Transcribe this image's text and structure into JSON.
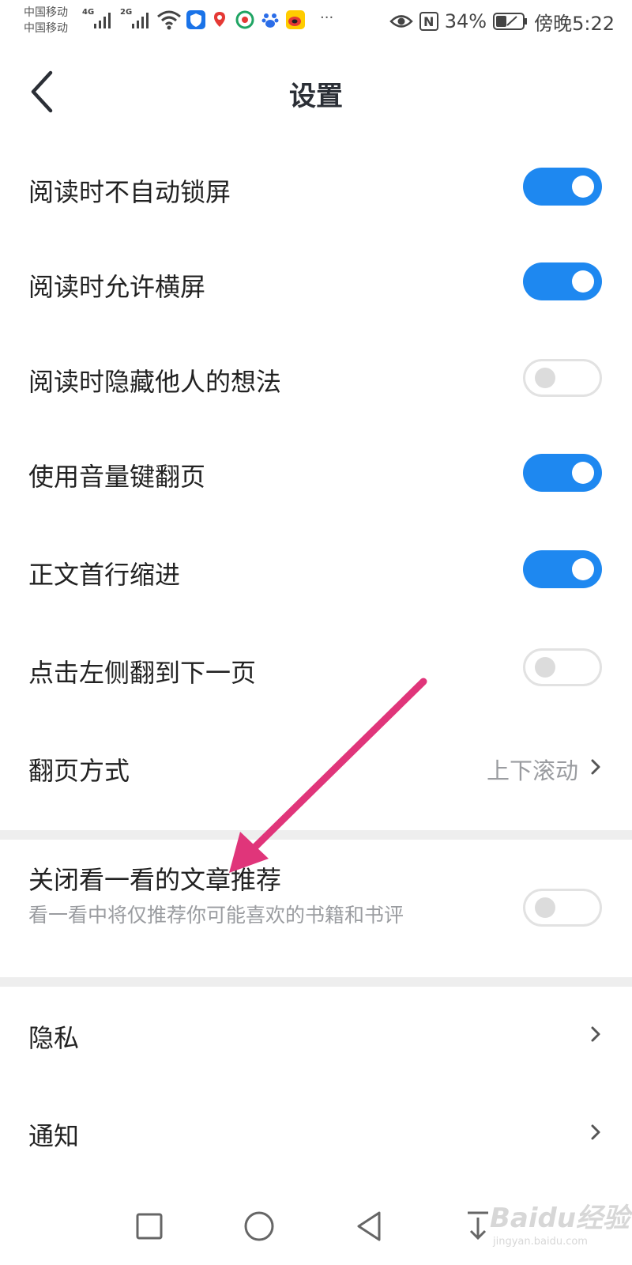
{
  "status_bar": {
    "carrier_1": "中国移动",
    "carrier_2": "中国移动",
    "net_1": "4G",
    "net_2": "2G",
    "nfc_label": "N",
    "battery": "34%",
    "time": "傍晚5:22",
    "more": "···",
    "icons": [
      "signal-4g-icon",
      "signal-2g-icon",
      "wifi-icon",
      "shield-app-icon",
      "map-app-icon",
      "browser-app-icon",
      "baidu-app-icon",
      "weibo-app-icon",
      "eye-icon",
      "nfc-icon",
      "battery-icon"
    ]
  },
  "header": {
    "title": "设置",
    "back_icon": "back-chevron-icon"
  },
  "settings": {
    "no_auto_lock": {
      "label": "阅读时不自动锁屏",
      "on": true
    },
    "allow_landscape": {
      "label": "阅读时允许横屏",
      "on": true
    },
    "hide_others_thoughts": {
      "label": "阅读时隐藏他人的想法",
      "on": false
    },
    "volume_key_page": {
      "label": "使用音量键翻页",
      "on": true
    },
    "first_line_indent": {
      "label": "正文首行缩进",
      "on": true
    },
    "tap_left_next": {
      "label": "点击左侧翻到下一页",
      "on": false
    },
    "page_turn_mode": {
      "label": "翻页方式",
      "value": "上下滚动"
    },
    "disable_recommend": {
      "label": "关闭看一看的文章推荐",
      "sublabel": "看一看中将仅推荐你可能喜欢的书籍和书评",
      "on": false
    },
    "privacy": {
      "label": "隐私"
    },
    "notifications": {
      "label": "通知"
    }
  },
  "colors": {
    "toggle_on": "#1e88f0",
    "annotation_arrow": "#e0357a"
  },
  "watermark": {
    "text": "Baidu经验",
    "url": "jingyan.baidu.com"
  },
  "nav_bar": [
    "recent-apps-square-icon",
    "home-circle-icon",
    "back-triangle-icon",
    "notification-pull-icon"
  ]
}
